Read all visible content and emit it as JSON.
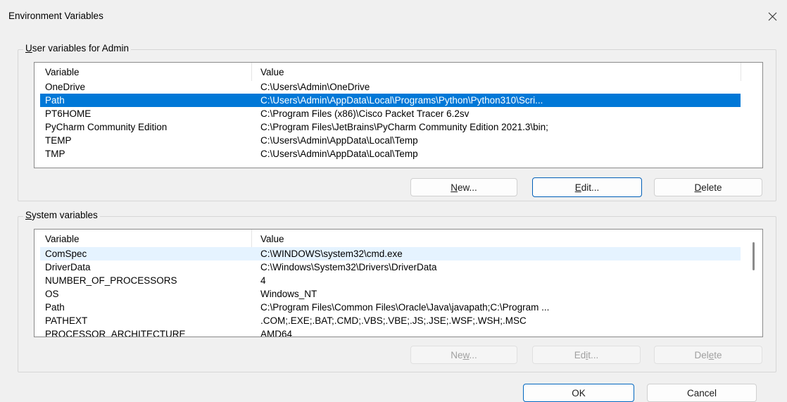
{
  "window": {
    "title": "Environment Variables"
  },
  "user_section": {
    "label_prefix": "",
    "label_access": "U",
    "label_rest": "ser variables for Admin",
    "columns": {
      "variable": "Variable",
      "value": "Value"
    },
    "rows": [
      {
        "variable": "OneDrive",
        "value": "C:\\Users\\Admin\\OneDrive"
      },
      {
        "variable": "Path",
        "value": "C:\\Users\\Admin\\AppData\\Local\\Programs\\Python\\Python310\\Scri..."
      },
      {
        "variable": "PT6HOME",
        "value": "C:\\Program Files (x86)\\Cisco Packet Tracer 6.2sv"
      },
      {
        "variable": "PyCharm Community Edition",
        "value": "C:\\Program Files\\JetBrains\\PyCharm Community Edition 2021.3\\bin;"
      },
      {
        "variable": "TEMP",
        "value": "C:\\Users\\Admin\\AppData\\Local\\Temp"
      },
      {
        "variable": "TMP",
        "value": "C:\\Users\\Admin\\AppData\\Local\\Temp"
      }
    ],
    "selected_index": 1,
    "buttons": {
      "new": {
        "access": "N",
        "rest": "ew..."
      },
      "edit": {
        "access": "E",
        "rest": "dit..."
      },
      "delete": {
        "access": "D",
        "rest": "elete"
      }
    }
  },
  "system_section": {
    "label_access": "S",
    "label_rest": "ystem variables",
    "columns": {
      "variable": "Variable",
      "value": "Value"
    },
    "rows": [
      {
        "variable": "ComSpec",
        "value": "C:\\WINDOWS\\system32\\cmd.exe"
      },
      {
        "variable": "DriverData",
        "value": "C:\\Windows\\System32\\Drivers\\DriverData"
      },
      {
        "variable": "NUMBER_OF_PROCESSORS",
        "value": "4"
      },
      {
        "variable": "OS",
        "value": "Windows_NT"
      },
      {
        "variable": "Path",
        "value": "C:\\Program Files\\Common Files\\Oracle\\Java\\javapath;C:\\Program ..."
      },
      {
        "variable": "PATHEXT",
        "value": ".COM;.EXE;.BAT;.CMD;.VBS;.VBE;.JS;.JSE;.WSF;.WSH;.MSC"
      },
      {
        "variable": "PROCESSOR_ARCHITECTURE",
        "value": "AMD64"
      }
    ],
    "hover_index": 0,
    "buttons": {
      "new": {
        "pre": "Ne",
        "access": "w",
        "rest": "..."
      },
      "edit": {
        "pre": "Ed",
        "access": "i",
        "rest": "t..."
      },
      "delete": {
        "pre": "Del",
        "access": "e",
        "rest": "te"
      }
    }
  },
  "footer": {
    "ok": "OK",
    "cancel": "Cancel"
  },
  "colors": {
    "selection": "#0078d7",
    "accent_border": "#005fb8"
  },
  "icons": {
    "close": "close-icon"
  }
}
